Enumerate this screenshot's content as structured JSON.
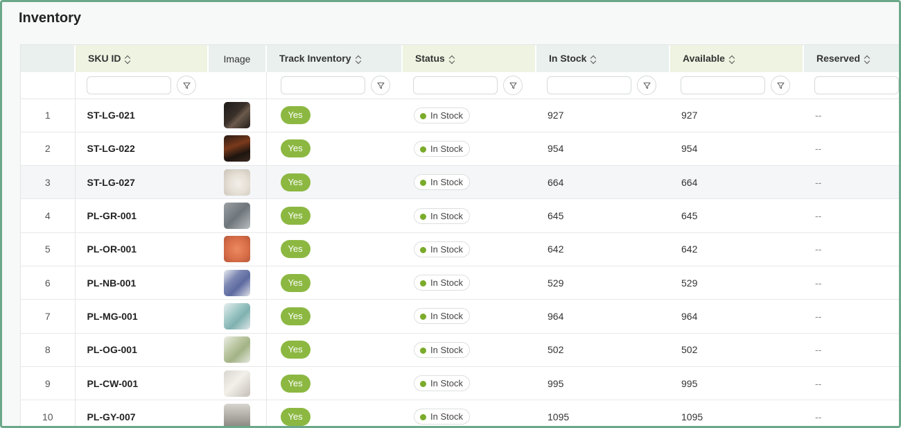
{
  "page": {
    "title": "Inventory"
  },
  "colors": {
    "accent_green": "#8cb842",
    "status_in_stock": "#7aab2a",
    "frame_border": "#6aa889"
  },
  "table": {
    "columns": [
      {
        "key": "sku",
        "label": "SKU ID",
        "sortable": true
      },
      {
        "key": "image",
        "label": "Image",
        "sortable": false
      },
      {
        "key": "track",
        "label": "Track Inventory",
        "sortable": true
      },
      {
        "key": "status",
        "label": "Status",
        "sortable": true
      },
      {
        "key": "in_stock",
        "label": "In Stock",
        "sortable": true
      },
      {
        "key": "available",
        "label": "Available",
        "sortable": true
      },
      {
        "key": "reserved",
        "label": "Reserved",
        "sortable": true
      }
    ],
    "rows": [
      {
        "index": "1",
        "sku": "ST-LG-021",
        "track": "Yes",
        "status": "In Stock",
        "in_stock": "927",
        "available": "927",
        "reserved": "--",
        "thumb": "dark-chair"
      },
      {
        "index": "2",
        "sku": "ST-LG-022",
        "track": "Yes",
        "status": "In Stock",
        "in_stock": "954",
        "available": "954",
        "reserved": "--",
        "thumb": "dark-room"
      },
      {
        "index": "3",
        "sku": "ST-LG-027",
        "track": "Yes",
        "status": "In Stock",
        "in_stock": "664",
        "available": "664",
        "reserved": "--",
        "thumb": "white-chair"
      },
      {
        "index": "4",
        "sku": "PL-GR-001",
        "track": "Yes",
        "status": "In Stock",
        "in_stock": "645",
        "available": "645",
        "reserved": "--",
        "thumb": "grey-pillow"
      },
      {
        "index": "5",
        "sku": "PL-OR-001",
        "track": "Yes",
        "status": "In Stock",
        "in_stock": "642",
        "available": "642",
        "reserved": "--",
        "thumb": "orange-pillow"
      },
      {
        "index": "6",
        "sku": "PL-NB-001",
        "track": "Yes",
        "status": "In Stock",
        "in_stock": "529",
        "available": "529",
        "reserved": "--",
        "thumb": "navy-pillow"
      },
      {
        "index": "7",
        "sku": "PL-MG-001",
        "track": "Yes",
        "status": "In Stock",
        "in_stock": "964",
        "available": "964",
        "reserved": "--",
        "thumb": "mint-pillow"
      },
      {
        "index": "8",
        "sku": "PL-OG-001",
        "track": "Yes",
        "status": "In Stock",
        "in_stock": "502",
        "available": "502",
        "reserved": "--",
        "thumb": "olive-pillow"
      },
      {
        "index": "9",
        "sku": "PL-CW-001",
        "track": "Yes",
        "status": "In Stock",
        "in_stock": "995",
        "available": "995",
        "reserved": "--",
        "thumb": "cream-pillow"
      },
      {
        "index": "10",
        "sku": "PL-GY-007",
        "track": "Yes",
        "status": "In Stock",
        "in_stock": "1095",
        "available": "1095",
        "reserved": "--",
        "thumb": "grey-sofa"
      }
    ],
    "highlighted_row": 3
  }
}
